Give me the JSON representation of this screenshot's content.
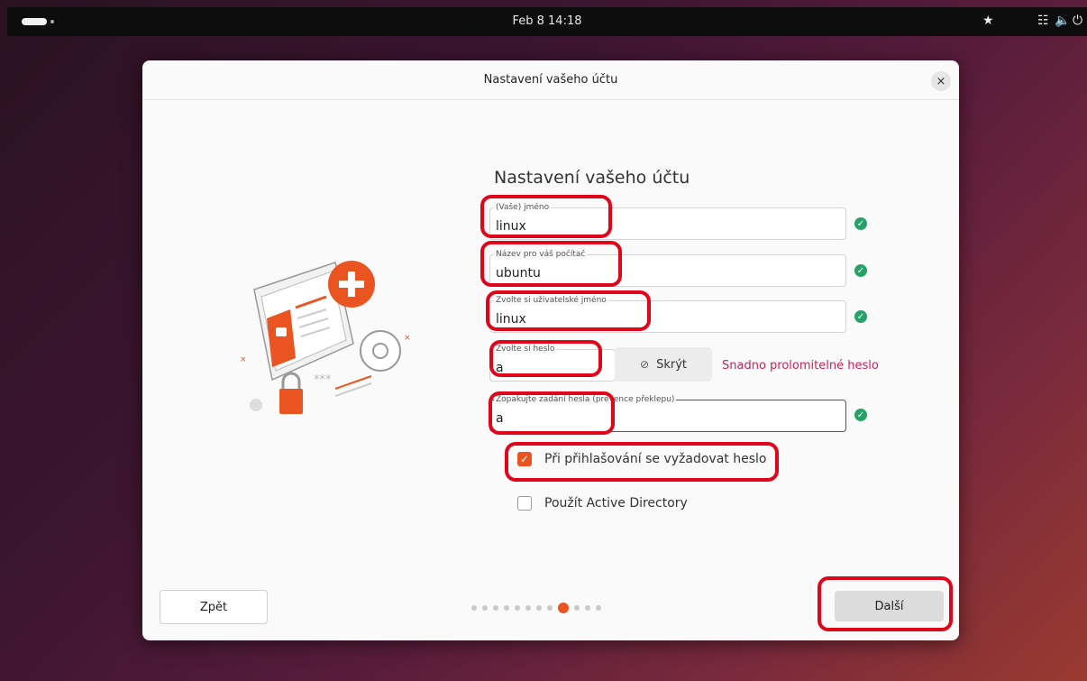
{
  "topbar": {
    "clock": "Feb 8  14:18",
    "icons": [
      "accessibility-icon",
      "network-icon",
      "volume-icon",
      "power-icon"
    ]
  },
  "dialog": {
    "title": "Nastavení vašeho účtu",
    "close_glyph": "×",
    "heading": "Nastavení vašeho účtu",
    "fields": {
      "name": {
        "label": "(Vaše) jméno",
        "value": "linux"
      },
      "hostname": {
        "label": "Název pro váš počítač",
        "value": "ubuntu"
      },
      "username": {
        "label": "Zvolte si uživatelské jméno",
        "value": "linux"
      },
      "password": {
        "label": "Zvolte si heslo",
        "value": "a"
      },
      "confirm": {
        "label": "Zopakujte zadání hesla (prevence překlepu)",
        "value": "a"
      }
    },
    "reveal_label": "Skrýt",
    "password_strength": "Snadno prolomitelné heslo",
    "require_password": {
      "label": "Při přihlašování se vyžadovat heslo",
      "checked": true
    },
    "active_directory": {
      "label": "Použít Active Directory",
      "checked": false
    },
    "back_label": "Zpět",
    "next_label": "Další",
    "pager": {
      "total": 12,
      "current": 9
    }
  },
  "colors": {
    "accent": "#e95420",
    "ok": "#26a269",
    "warning": "#c7245b",
    "annotation": "#e0061a"
  }
}
